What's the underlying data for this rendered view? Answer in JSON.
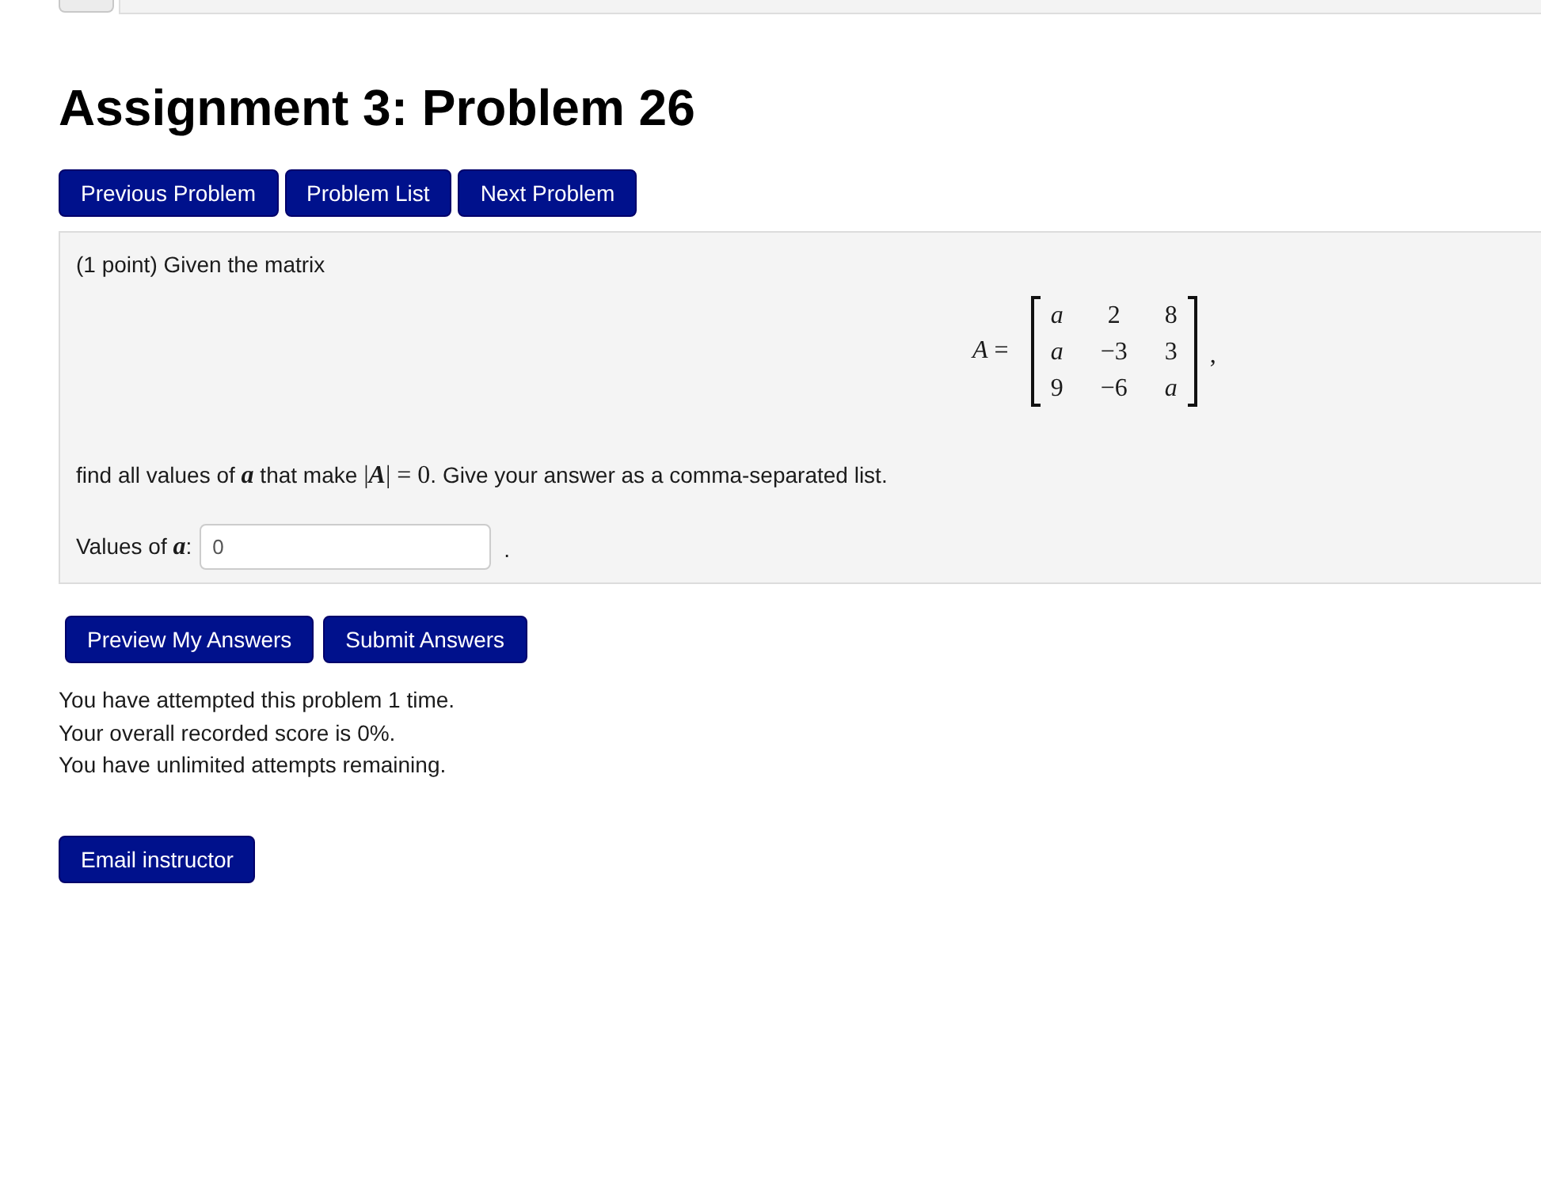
{
  "page_title": "Assignment 3: Problem 26",
  "nav_buttons": [
    "Previous Problem",
    "Problem List",
    "Next Problem"
  ],
  "problem": {
    "intro": "(1 point) Given the matrix",
    "equation": {
      "lhs": "A",
      "relation": "=",
      "rows": [
        [
          {
            "kind": "var",
            "text": "a"
          },
          {
            "kind": "num",
            "text": "2"
          },
          {
            "kind": "num",
            "text": "8"
          }
        ],
        [
          {
            "kind": "var",
            "text": "a"
          },
          {
            "kind": "num",
            "text": "−3"
          },
          {
            "kind": "num",
            "text": "3"
          }
        ],
        [
          {
            "kind": "num",
            "text": "9"
          },
          {
            "kind": "num",
            "text": "−6"
          },
          {
            "kind": "var",
            "text": "a"
          }
        ]
      ],
      "trailing": ","
    },
    "instruction": [
      {
        "kind": "text",
        "text": "find all values of "
      },
      {
        "kind": "var",
        "text": "a"
      },
      {
        "kind": "text",
        "text": " that make "
      },
      {
        "kind": "sym",
        "text": "|"
      },
      {
        "kind": "var",
        "text": "A"
      },
      {
        "kind": "sym",
        "text": "| = 0"
      },
      {
        "kind": "text",
        "text": ". Give your answer as a comma-separated list."
      }
    ],
    "answer": {
      "label": [
        {
          "kind": "text",
          "text": "Values of "
        },
        {
          "kind": "var",
          "text": "a"
        },
        {
          "kind": "text",
          "text": ":"
        }
      ],
      "value": "0",
      "after": "."
    }
  },
  "answer_buttons": [
    "Preview My Answers",
    "Submit Answers"
  ],
  "status_lines": [
    "You have attempted this problem 1 time.",
    "Your overall recorded score is 0%.",
    "You have unlimited attempts remaining."
  ],
  "email_button": "Email instructor"
}
